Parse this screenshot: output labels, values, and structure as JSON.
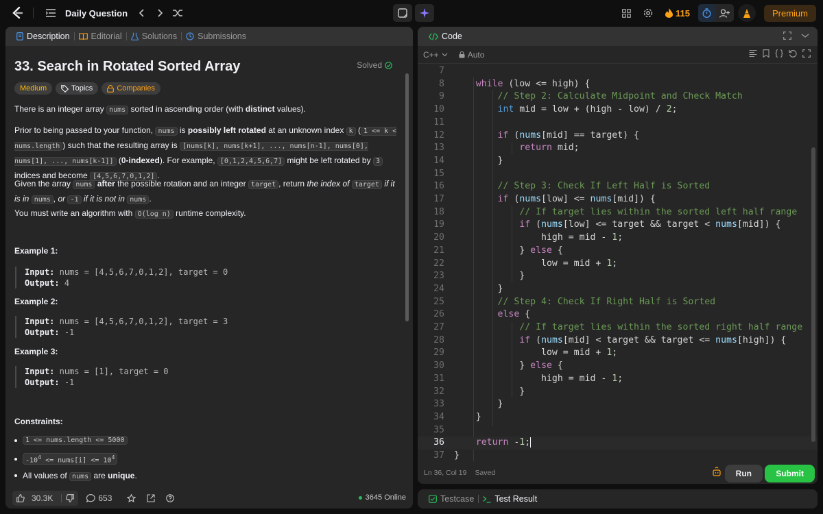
{
  "topbar": {
    "title": "Daily Question",
    "streak": "115",
    "premium": "Premium"
  },
  "left": {
    "tabs": [
      {
        "label": "Description"
      },
      {
        "label": "Editorial"
      },
      {
        "label": "Solutions"
      },
      {
        "label": "Submissions"
      }
    ],
    "title": "33. Search in Rotated Sorted Array",
    "status": "Solved",
    "chips": {
      "difficulty": "Medium",
      "topics": "Topics",
      "companies": "Companies"
    },
    "examples": [
      {
        "title": "Example 1:",
        "input": "nums = [4,5,6,7,0,1,2], target = 0",
        "output": "4"
      },
      {
        "title": "Example 2:",
        "input": "nums = [4,5,6,7,0,1,2], target = 3",
        "output": "-1"
      },
      {
        "title": "Example 3:",
        "input": "nums = [1], target = 0",
        "output": "-1"
      }
    ],
    "labels": {
      "input": "Input:",
      "output": "Output:",
      "constraints": "Constraints:"
    },
    "footer": {
      "likes": "30.3K",
      "comments": "653",
      "online": "3645 Online"
    }
  },
  "code": {
    "tab": "Code",
    "language": "C++",
    "mode": "Auto",
    "status_position": "Ln 36, Col 19",
    "status_saved": "Saved",
    "run": "Run",
    "submit": "Submit",
    "current_line": 36
  },
  "bottom": {
    "tabs": [
      {
        "label": "Testcase"
      },
      {
        "label": "Test Result"
      }
    ]
  },
  "colors": {
    "accent": "#ffa116",
    "submit": "#28c244",
    "background": "#262626"
  }
}
